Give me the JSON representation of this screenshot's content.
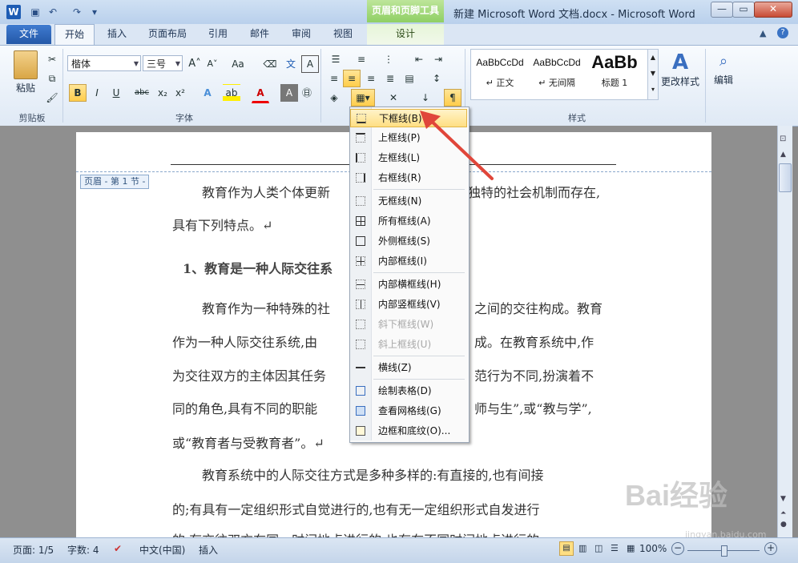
{
  "titlebar": {
    "app_logo": "W",
    "context_tool_label": "页眉和页脚工具",
    "doc_title": "新建 Microsoft Word 文档.docx - Microsoft Word"
  },
  "tabs": [
    {
      "label": "文件"
    },
    {
      "label": "开始"
    },
    {
      "label": "插入"
    },
    {
      "label": "页面布局"
    },
    {
      "label": "引用"
    },
    {
      "label": "邮件"
    },
    {
      "label": "审阅"
    },
    {
      "label": "视图"
    },
    {
      "label": "设计"
    }
  ],
  "ribbon": {
    "clipboard": {
      "paste": "粘贴",
      "group": "剪贴板"
    },
    "font": {
      "name": "楷体",
      "size": "三号",
      "group": "字体"
    },
    "styles": {
      "items": [
        {
          "sample": "AaBbCcDd",
          "name": "↵ 正文"
        },
        {
          "sample": "AaBbCcDd",
          "name": "↵ 无间隔"
        },
        {
          "sample": "AaBb",
          "name": "标题 1"
        }
      ],
      "change": "更改样式",
      "group": "样式"
    },
    "edit": {
      "label": "编辑"
    }
  },
  "document": {
    "header_tag": "页眉 - 第 1 节 -",
    "lines": [
      "教育作为人类个体更新",
      "独特的社会机制而存在,",
      "具有下列特点。↵",
      "1、教育是一种人际交往系",
      "教育作为一种特殊的社",
      "之间的交往构成。教育",
      "作为一种人际交往系统,由",
      "成。在教育系统中,作",
      "为交往双方的主体因其任务",
      "范行为不同,扮演着不",
      "同的角色,具有不同的职能",
      "师与生”,或“教与学”,",
      "或“教育者与受教育者”。↵",
      "教育系统中的人际交往方式是多种多样的:有直接的,也有间接",
      "的;有具有一定组织形式自觉进行的,也有无一定组织形式自发进行",
      "的,有交往双方在同一时间地点进行的,也有在不同时间地点进行的"
    ]
  },
  "border_menu": {
    "items": [
      {
        "label": "下框线(B)",
        "enabled": true,
        "highlighted": true
      },
      {
        "label": "上框线(P)",
        "enabled": true
      },
      {
        "label": "左框线(L)",
        "enabled": true
      },
      {
        "label": "右框线(R)",
        "enabled": true
      },
      {
        "label": "无框线(N)",
        "enabled": true
      },
      {
        "label": "所有框线(A)",
        "enabled": true
      },
      {
        "label": "外侧框线(S)",
        "enabled": true
      },
      {
        "label": "内部框线(I)",
        "enabled": true
      },
      {
        "label": "内部横框线(H)",
        "enabled": true
      },
      {
        "label": "内部竖框线(V)",
        "enabled": true
      },
      {
        "label": "斜下框线(W)",
        "enabled": false
      },
      {
        "label": "斜上框线(U)",
        "enabled": false
      },
      {
        "label": "横线(Z)",
        "enabled": true
      },
      {
        "label": "绘制表格(D)",
        "enabled": true
      },
      {
        "label": "查看网格线(G)",
        "enabled": true
      },
      {
        "label": "边框和底纹(O)...",
        "enabled": true
      }
    ]
  },
  "statusbar": {
    "page": "页面: 1/5",
    "words": "字数: 4",
    "language": "中文(中国)",
    "mode": "插入",
    "zoom": "100%"
  },
  "watermark": {
    "main": "Bai经验",
    "sub": "jingyan.baidu.com"
  },
  "colors": {
    "accent": "#2458a8",
    "context_green": "#8fcf64",
    "highlight": "#ffdf83",
    "arrow": "#e0463a"
  }
}
